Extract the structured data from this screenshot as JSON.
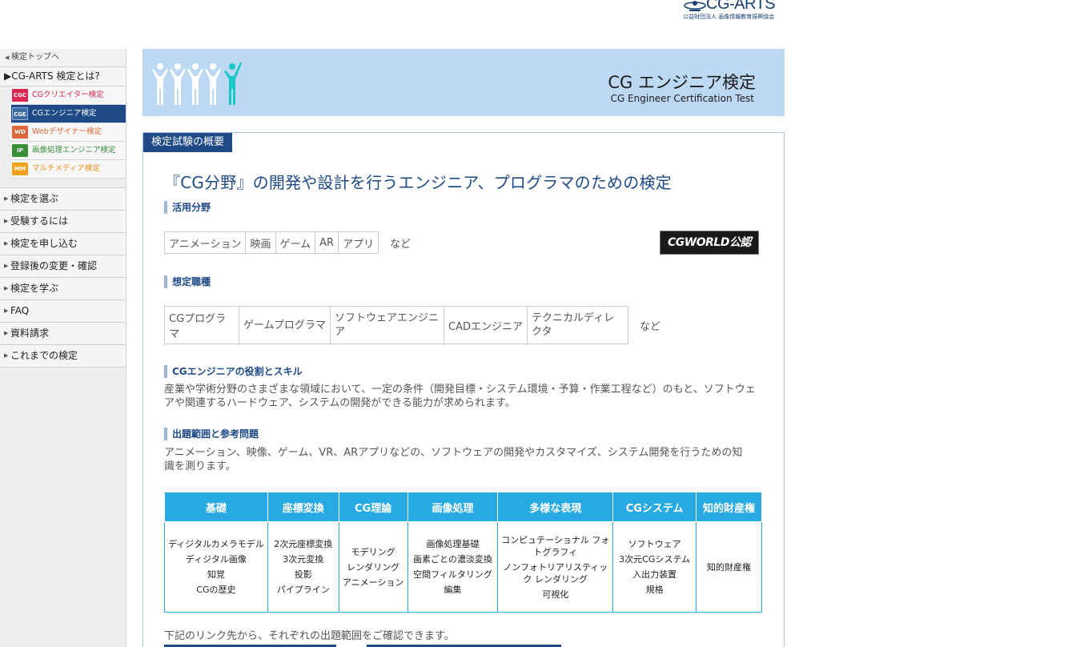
{
  "logo": {
    "text": "CG-ARTS",
    "subtitle": "公益財団法人 画像情報教育振興協会",
    "icon": "cg-arts-logo-mark"
  },
  "sidebar": {
    "top_link": "検定トップへ",
    "about": "CG-ARTS 検定とは?",
    "exams": [
      {
        "badge": "CGC",
        "label": "CGクリエイター検定",
        "color": "#d9274f",
        "active": false
      },
      {
        "badge": "CGE",
        "label": "CGエンジニア検定",
        "color": "#1e4a87",
        "active": true
      },
      {
        "badge": "WD",
        "label": "Webデザイナー検定",
        "color": "#e0673a",
        "active": false
      },
      {
        "badge": "IP",
        "label": "画像処理エンジニア検定",
        "color": "#3b8f3b",
        "active": false
      },
      {
        "badge": "MM",
        "label": "マルチメディア検定",
        "color": "#f2a11f",
        "active": false
      }
    ],
    "menu": [
      "検定を選ぶ",
      "受験するには",
      "検定を申し込む",
      "登録後の変更・確認",
      "検定を学ぶ",
      "FAQ",
      "資料請求",
      "これまでの検定"
    ]
  },
  "banner": {
    "title": "CG エンジニア検定",
    "subtitle": "CG Engineer Certification Test",
    "icon": "people-icon"
  },
  "content": {
    "section_tab": "検定試験の概要",
    "headline": "『CG分野』の開発や設計を行うエンジニア、プログラマのための検定",
    "fields_heading": "活用分野",
    "fields": [
      "アニメーション",
      "映画",
      "ゲーム",
      "AR",
      "アプリ"
    ],
    "fields_etc": "など",
    "cgworld_badge": "CGWORLD公認",
    "jobs_heading": "想定職種",
    "jobs": [
      "CGプログラマ",
      "ゲームプログラマ",
      "ソフトウェアエンジニア",
      "CADエンジニア",
      "テクニカルディレクタ"
    ],
    "jobs_etc": "など",
    "role_heading": "CGエンジニアの役割とスキル",
    "role_text": "産業や学術分野のさまざまな領域において、一定の条件（開発目標・システム環境・予算・作業工程など）のもと、ソフトウェアや関連するハードウェア、システムの開発ができる能力が求められます。",
    "scope_heading": "出題範囲と参考問題",
    "scope_text": "アニメーション、映像、ゲーム、VR、ARアプリなどの、ソフトウェアの開発やカスタマイズ、システム開発を行うための知識を測ります。",
    "categories": [
      {
        "title": "基礎",
        "items": [
          "ディジタルカメラモデル",
          "ディジタル画像",
          "知覚",
          "CGの歴史"
        ]
      },
      {
        "title": "座標変換",
        "items": [
          "2次元座標変換",
          "3次元変換",
          "投影",
          "パイプライン"
        ]
      },
      {
        "title": "CG理論",
        "items": [
          "モデリング",
          "レンダリング",
          "アニメーション"
        ]
      },
      {
        "title": "画像処理",
        "items": [
          "画像処理基礎",
          "画素ごとの濃淡変換",
          "空間フィルタリング",
          "編集"
        ]
      },
      {
        "title": "多様な表現",
        "items": [
          "コンピュテーショナル フォトグラフィ",
          "ノンフォトリアリスティック レンダリング",
          "可視化"
        ]
      },
      {
        "title": "CGシステム",
        "items": [
          "ソフトウェア",
          "3次元CGシステム",
          "入出力装置",
          "規格"
        ]
      },
      {
        "title": "知的財産権",
        "items": [
          "知的財産権"
        ]
      }
    ],
    "link_intro": "下記のリンク先から、それぞれの出題範囲をご確認できます。"
  }
}
